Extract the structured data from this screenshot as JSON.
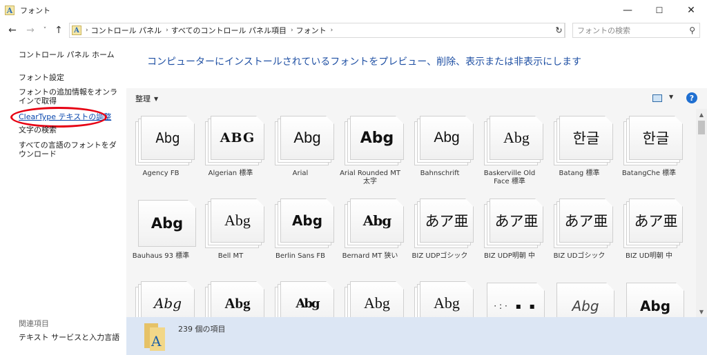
{
  "window": {
    "title": "フォント",
    "minimize": "—",
    "maximize": "☐",
    "close": "✕"
  },
  "nav": {
    "back": "←",
    "forward": "→",
    "recent": "˅",
    "up": "↑",
    "breadcrumbs": [
      "コントロール パネル",
      "すべてのコントロール パネル項目",
      "フォント"
    ],
    "separator": "›",
    "refresh": "↻",
    "search_placeholder": "フォントの検索"
  },
  "sidebar": {
    "home": "コントロール パネル ホーム",
    "items": [
      "フォント設定",
      "フォントの追加情報をオンラインで取得",
      "ClearType テキストの調整",
      "文字の検索",
      "すべての言語のフォントをダウンロード"
    ],
    "related_heading": "関連項目",
    "related_items": [
      "テキスト サービスと入力言語"
    ]
  },
  "main": {
    "heading": "コンピューターにインストールされているフォントをプレビュー、削除、表示または非表示にします",
    "organize_label": "整理",
    "help": "?"
  },
  "fonts": [
    {
      "name": "Agency FB",
      "sample": "Abg"
    },
    {
      "name": "Algerian 標準",
      "sample": "ABG"
    },
    {
      "name": "Arial",
      "sample": "Abg"
    },
    {
      "name": "Arial Rounded MT 太字",
      "sample": "Abg"
    },
    {
      "name": "Bahnschrift",
      "sample": "Abg"
    },
    {
      "name": "Baskerville Old Face 標準",
      "sample": "Abg"
    },
    {
      "name": "Batang 標準",
      "sample": "한글"
    },
    {
      "name": "BatangChe 標準",
      "sample": "한글"
    },
    {
      "name": "Bauhaus 93 標準",
      "sample": "Abg"
    },
    {
      "name": "Bell MT",
      "sample": "Abg"
    },
    {
      "name": "Berlin Sans FB",
      "sample": "Abg"
    },
    {
      "name": "Bernard MT 狭い",
      "sample": "Abg"
    },
    {
      "name": "BIZ UDPゴシック",
      "sample": "あア亜"
    },
    {
      "name": "BIZ UDP明朝 中",
      "sample": "あア亜"
    },
    {
      "name": "BIZ UDゴシック",
      "sample": "あア亜"
    },
    {
      "name": "BIZ UD明朝 中",
      "sample": "あア亜"
    },
    {
      "name": "",
      "sample": "Abg"
    },
    {
      "name": "",
      "sample": "Abg"
    },
    {
      "name": "",
      "sample": "Abg"
    },
    {
      "name": "",
      "sample": "Abg"
    },
    {
      "name": "",
      "sample": "Abg"
    },
    {
      "name": "",
      "sample": "·:· ▪ ▪"
    },
    {
      "name": "",
      "sample": "Abg"
    },
    {
      "name": "",
      "sample": "Abg"
    }
  ],
  "details": {
    "count": "239 個の項目"
  },
  "colors": {
    "heading": "#1e4fa3",
    "highlight_circle": "#e60012",
    "details_bg": "#dce6f4"
  }
}
